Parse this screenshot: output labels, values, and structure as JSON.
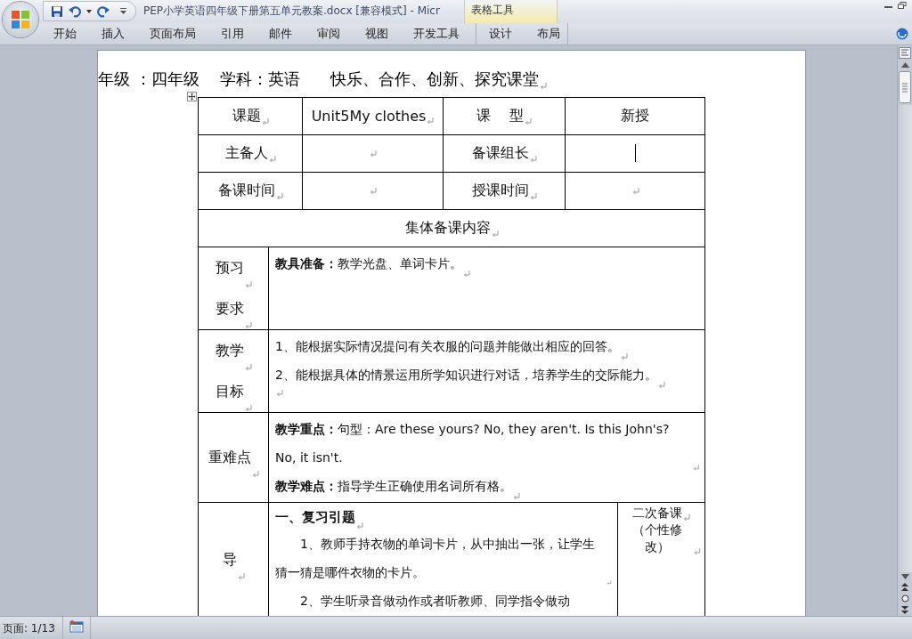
{
  "title_bar": {
    "quick_access": [
      {
        "kind": "save"
      },
      {
        "kind": "undo"
      },
      {
        "kind": "dropdown"
      },
      {
        "kind": "redo"
      },
      {
        "kind": "customize"
      }
    ],
    "title": "PEP小学英语四年级下册第五单元教案.docx [兼容模式] - Micr",
    "context_tab": "表格工具"
  },
  "ribbon_tabs": [
    {
      "label": "开始"
    },
    {
      "label": "插入"
    },
    {
      "label": "页面布局"
    },
    {
      "label": "引用"
    },
    {
      "label": "邮件"
    },
    {
      "label": "审阅"
    },
    {
      "label": "视图"
    },
    {
      "label": "开发工具"
    }
  ],
  "table_tools_tabs": [
    {
      "label": "设计"
    },
    {
      "label": "布局"
    }
  ],
  "document": {
    "heading": {
      "text": "年级 ：四年级    学科：英语      快乐、合作、创新、探究课堂",
      "para_mark": true
    },
    "table": {
      "rows": [
        {
          "kind": "info",
          "cells": [
            {
              "text": "课题",
              "para_mark": true
            },
            {
              "text": "Unit5My clothes",
              "para_mark": true
            },
            {
              "text": "课    型",
              "para_mark": true
            },
            {
              "text": "新授",
              "para_mark": false
            }
          ]
        },
        {
          "kind": "info",
          "cells": [
            {
              "text": "主备人",
              "para_mark": true
            },
            {
              "para_mark": true
            },
            {
              "text": "备课组长",
              "para_mark": true
            },
            {
              "para_mark": false,
              "cursor": true
            }
          ]
        },
        {
          "kind": "info",
          "cells": [
            {
              "text": "备课时间",
              "para_mark": true
            },
            {
              "para_mark": true
            },
            {
              "text": "授课时间",
              "para_mark": true
            },
            {
              "para_mark": true
            }
          ]
        },
        {
          "kind": "banner",
          "cells": [
            {
              "text": "集体备课内容",
              "para_mark": true
            }
          ]
        },
        {
          "kind": "section",
          "label": [
            {
              "text": "预习",
              "para_mark": true
            },
            {
              "text": "要求",
              "para_mark": true
            }
          ],
          "content": [
            {
              "kind": "plain",
              "text": "**教具准备：**教学光盘、单词卡片。",
              "para_mark": true
            }
          ]
        },
        {
          "kind": "section",
          "label": [
            {
              "text": "教学",
              "para_mark": true
            },
            {
              "text": "目标",
              "para_mark": true
            }
          ],
          "content": [
            {
              "kind": "plain",
              "text": "1、能根据实际情况提问有关衣服的问题并能做出相应的回答。",
              "para_mark": true
            },
            {
              "kind": "plain",
              "text": "2、能根据具体的情景运用所学知识进行对话，培养学生的交际能力。",
              "para_mark": true
            },
            {
              "kind": "plain",
              "para_mark": true
            }
          ]
        },
        {
          "kind": "section",
          "label": [
            {
              "text": "重难点",
              "para_mark": true
            }
          ],
          "content": [
            {
              "kind": "plain",
              "text": "**教学重点：**句型：Are these yours? No, they aren't. Is this John's? No, it isn't.",
              "para_mark": true
            },
            {
              "kind": "plain",
              "text": "**教学难点：**指导学生正确使用名词所有格。",
              "para_mark": true
            }
          ]
        },
        {
          "kind": "section_side",
          "label": [
            {
              "text": "导",
              "para_mark": true
            }
          ],
          "content": [
            {
              "kind": "heading",
              "text": "一、复习引题",
              "para_mark": true
            },
            {
              "kind": "indent",
              "text": "1、教师手持衣物的单词卡片，从中抽出一张，让学生猜一猜是哪件衣物的卡片。",
              "para_mark": true
            },
            {
              "kind": "indent",
              "text": "2、学生听录音做动作或者听教师、同学指令做动",
              "para_mark": false
            }
          ],
          "side": [
            {
              "text": "二次备课",
              "para_mark": true
            },
            {
              "text": "（个性修改）",
              "para_mark": true
            }
          ]
        }
      ]
    }
  },
  "status_bar": {
    "page": "页面: 1/13"
  }
}
